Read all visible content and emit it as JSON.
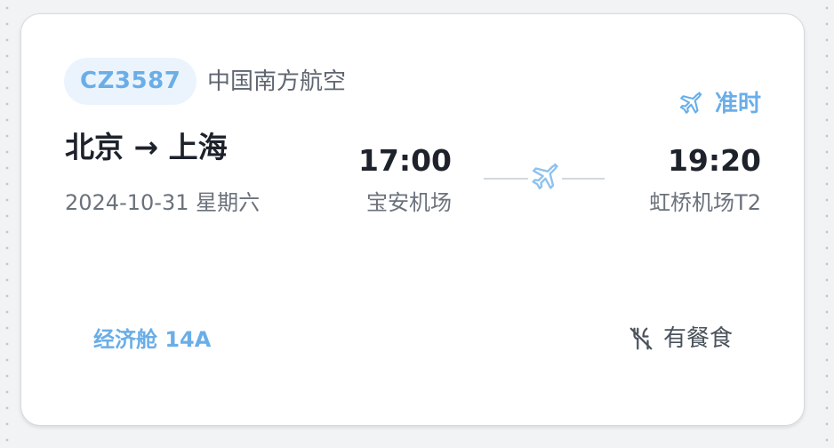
{
  "flight": {
    "number": "CZ3587",
    "airline": "中国南方航空",
    "status": "准时",
    "route": "北京 → 上海",
    "date": "2024-10-31 星期六",
    "departure": {
      "time": "17:00",
      "airport": "宝安机场"
    },
    "arrival": {
      "time": "19:20",
      "airport": "虹桥机场T2"
    },
    "cabin": "经济舱 14A",
    "meal": "有餐食"
  },
  "icons": {
    "status": "airplane-icon",
    "connector": "airplane-icon",
    "meal": "no-utensils-icon"
  },
  "colors": {
    "accent": "#6aaee8",
    "badge_bg": "#ebf4fd",
    "text_primary": "#1d222b",
    "text_secondary": "#6b727c"
  }
}
